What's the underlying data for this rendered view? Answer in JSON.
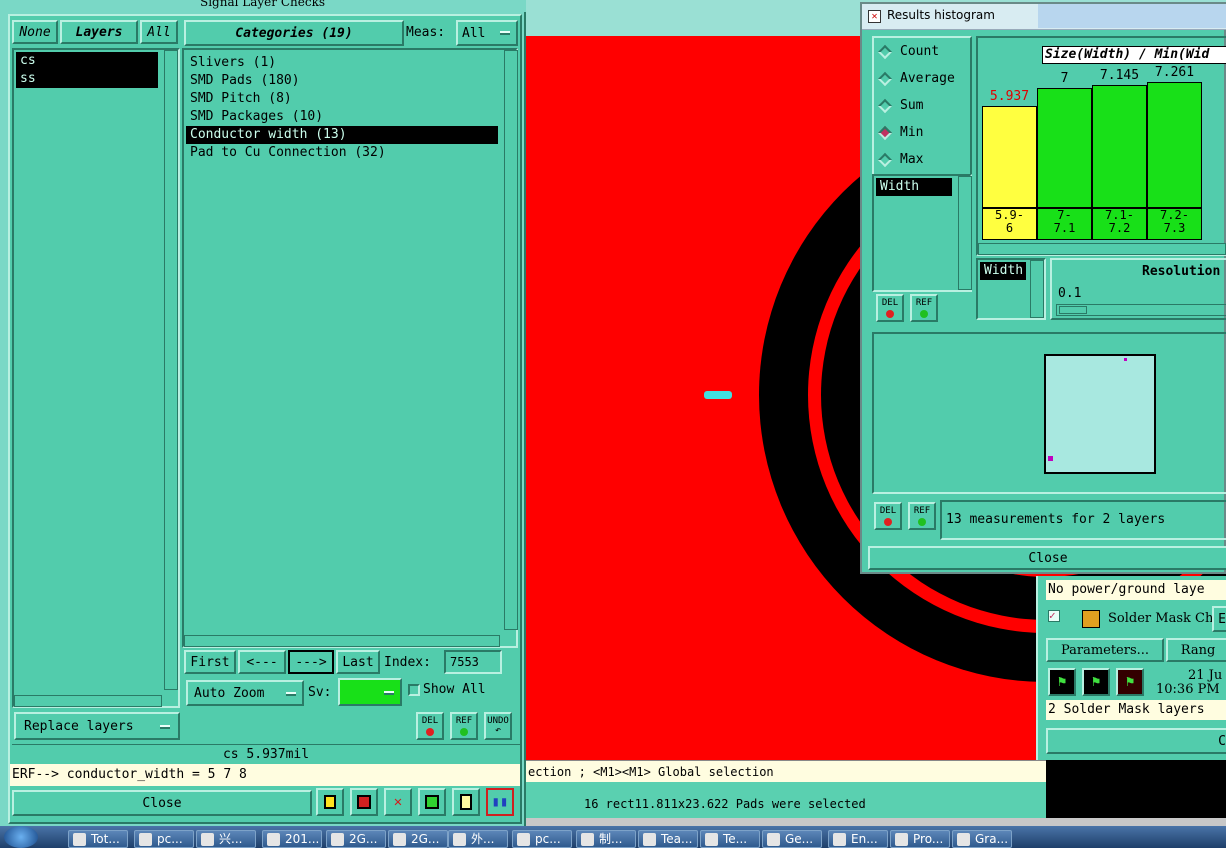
{
  "canvas": {
    "colors": {
      "background": "#ff0000",
      "copper": "#000000",
      "highlight": "#40e0e0"
    }
  },
  "left_window": {
    "title": "Signal Layer Checks",
    "layers_panel": {
      "none_btn": "None",
      "layers_btn": "Layers",
      "all_btn": "All",
      "items": [
        {
          "label": "cs",
          "selected": true
        },
        {
          "label": "ss",
          "selected": true
        }
      ]
    },
    "categories_header": "Categories (19)",
    "meas_label": "Meas:",
    "meas_value": "All",
    "categories": [
      {
        "label": "Slivers (1)",
        "selected": false
      },
      {
        "label": "SMD Pads (180)",
        "selected": false
      },
      {
        "label": "SMD Pitch (8)",
        "selected": false
      },
      {
        "label": "SMD Packages (10)",
        "selected": false
      },
      {
        "label": "Conductor width (13)",
        "selected": true
      },
      {
        "label": "Pad to Cu Connection (32)",
        "selected": false
      }
    ],
    "nav": {
      "first": "First",
      "prev": "<---",
      "next": "--->",
      "last": "Last",
      "index_label": "Index:",
      "index_value": "7553"
    },
    "auto_zoom": "Auto Zoom",
    "sv_label": "Sv:",
    "show_all": "Show All",
    "replace_layers": "Replace layers",
    "del": "DEL",
    "ref": "REF",
    "undo": "UNDO",
    "status_value": "cs 5.937mil",
    "erf_line": "ERF--> conductor_width = 5 7 8",
    "close": "Close"
  },
  "histogram_window": {
    "title": "Results histogram",
    "modes": [
      {
        "label": "Count",
        "selected": false
      },
      {
        "label": "Average",
        "selected": false
      },
      {
        "label": "Sum",
        "selected": false
      },
      {
        "label": "Min",
        "selected": true
      },
      {
        "label": "Max",
        "selected": false
      }
    ],
    "measure_item": "Width",
    "chart_title": "Size(Width) / Min(Wid",
    "bars": [
      {
        "value": "5.937",
        "level": 0.73,
        "color": "#ffff40",
        "range": "5.9-\n6",
        "value_color": "#e00000"
      },
      {
        "value": "7",
        "level": 0.86,
        "color": "#18e018",
        "range": "7-\n7.1",
        "value_color": "#000000"
      },
      {
        "value": "7.145",
        "level": 0.88,
        "color": "#18e018",
        "range": "7.1-\n7.2",
        "value_color": "#000000"
      },
      {
        "value": "7.261",
        "level": 0.9,
        "color": "#18e018",
        "range": "7.2-\n7.3",
        "value_color": "#000000"
      }
    ],
    "width_list_item": "Width",
    "resolution_label": "Resolution",
    "resolution_value": "0.1",
    "del": "DEL",
    "ref": "REF",
    "summary": "13 measurements for 2 layers",
    "close": "Close"
  },
  "solder_window": {
    "no_power_text": "No power/ground laye",
    "solder_mask_label": "Solder Mask Ch",
    "solder_mask_suffix": "E",
    "parameters": "Parameters...",
    "ranges": "Rang",
    "date": "21 Ju",
    "time": "10:36 PM",
    "summary": "2 Solder Mask layers",
    "close": "C"
  },
  "status_bar": {
    "line1": "ection ; <M1><M1> Global selection",
    "line2": "16 rect11.811x23.622 Pads were selected"
  },
  "taskbar": {
    "items": [
      "Tot...",
      "pc...",
      "兴...",
      "201...",
      "2G...",
      "2G...",
      "外...",
      "pc...",
      "制...",
      "Tea...",
      "Te...",
      "Ge...",
      "En...",
      "Pro...",
      "Gra..."
    ]
  }
}
